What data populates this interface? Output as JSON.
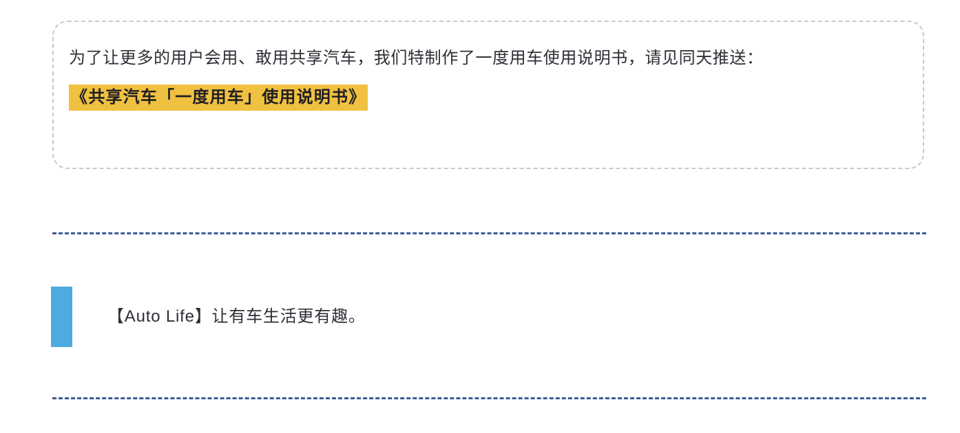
{
  "document": {
    "background_color": "#ffffff",
    "callout": {
      "border_color": "#c9c9c9",
      "paragraph": "为了让更多的用户会用、敢用共享汽车，我们特制作了一度用车使用说明书，请见同天推送：",
      "highlight_title": "《共享汽车「一度用车」使用说明书》",
      "highlight_color": "#f0c040",
      "highlight_text_color": "#1e1e24"
    },
    "dividers": {
      "color": "#3c5a96",
      "style": "dashed",
      "count": 2
    },
    "quote": {
      "accent_bar_color": "#4eabdf",
      "text": "【Auto Life】让有车生活更有趣。"
    },
    "text_color": "#2e2e36"
  }
}
